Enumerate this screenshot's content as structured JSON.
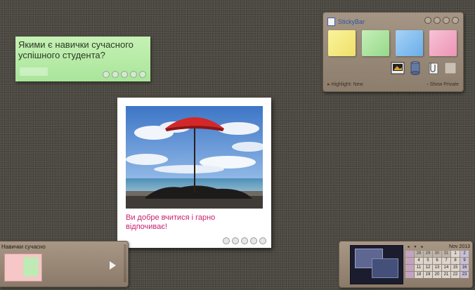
{
  "sticky_note": {
    "text": "Якими є навички сучасного успішного студента?",
    "color": "#b6eaa5"
  },
  "photo_card": {
    "caption": "Ви добре вчитися і гарно відпочиває!",
    "caption_color": "#c8206e",
    "photo_icon": "beach-umbrella-photo"
  },
  "stickybar": {
    "title": "StickyBar",
    "swatches": [
      {
        "name": "yellow",
        "color": "#f4ea78"
      },
      {
        "name": "green",
        "color": "#a6e29a"
      },
      {
        "name": "blue",
        "color": "#7ab8ee"
      },
      {
        "name": "pink",
        "color": "#f2a4c0"
      }
    ],
    "tools": [
      "photo-icon",
      "database-icon",
      "paperclip-icon",
      "blank-note-icon"
    ],
    "footer_left": "Highlight: New",
    "footer_right": "Show Private"
  },
  "tray": {
    "title": "Навички сучасно"
  },
  "calendar": {
    "month": "Nov 2013",
    "rows": [
      [
        "",
        "28",
        "29",
        "30",
        "31",
        "1",
        "2"
      ],
      [
        "",
        "4",
        "5",
        "6",
        "7",
        "8",
        "9"
      ],
      [
        "",
        "11",
        "12",
        "13",
        "14",
        "15",
        "16"
      ],
      [
        "",
        "18",
        "19",
        "20",
        "21",
        "22",
        "23"
      ]
    ]
  }
}
